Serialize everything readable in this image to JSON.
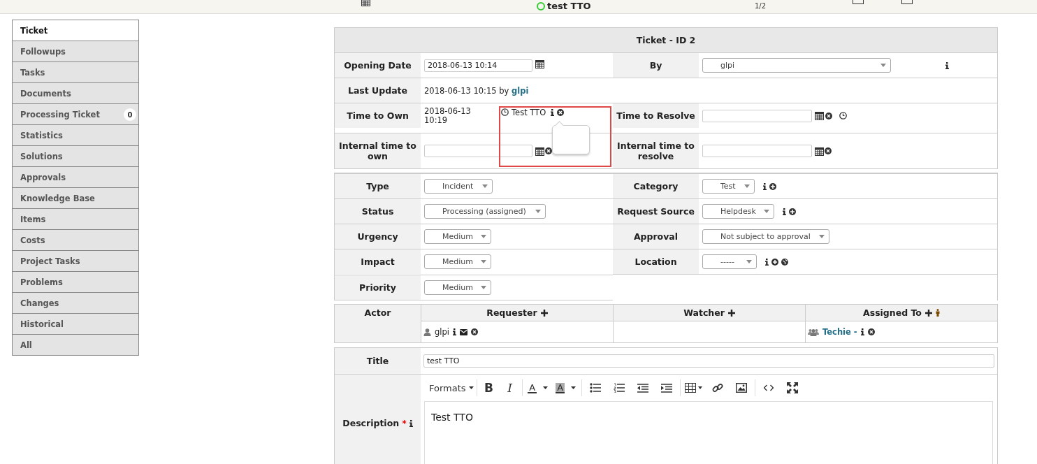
{
  "topbar": {
    "title": "test TTO",
    "counter": "1/2"
  },
  "tabs": [
    {
      "label": "Ticket",
      "selected": true
    },
    {
      "label": "Followups",
      "selected": false
    },
    {
      "label": "Tasks",
      "selected": false
    },
    {
      "label": "Documents",
      "selected": false
    },
    {
      "label": "Processing Ticket",
      "selected": false,
      "badge": "0"
    },
    {
      "label": "Statistics",
      "selected": false
    },
    {
      "label": "Solutions",
      "selected": false
    },
    {
      "label": "Approvals",
      "selected": false
    },
    {
      "label": "Knowledge Base",
      "selected": false
    },
    {
      "label": "Items",
      "selected": false
    },
    {
      "label": "Costs",
      "selected": false
    },
    {
      "label": "Project Tasks",
      "selected": false
    },
    {
      "label": "Problems",
      "selected": false
    },
    {
      "label": "Changes",
      "selected": false
    },
    {
      "label": "Historical",
      "selected": false
    },
    {
      "label": "All",
      "selected": false
    }
  ],
  "form": {
    "header": "Ticket - ID 2",
    "opening_date": {
      "label": "Opening Date",
      "value": "2018-06-13 10:14"
    },
    "by": {
      "label": "By",
      "value": "glpi"
    },
    "last_update": {
      "label": "Last Update",
      "text": "2018-06-13 10:15 by",
      "user": "glpi"
    },
    "time_to_own": {
      "label": "Time to Own",
      "value": "2018-06-13 10:19",
      "sla": "Test TTO"
    },
    "time_to_resolve": {
      "label": "Time to Resolve"
    },
    "internal_time_to_own": {
      "label": "Internal time to own"
    },
    "internal_time_to_resolve": {
      "label": "Internal time to resolve"
    },
    "fields": [
      {
        "label": "Type",
        "value": "Incident"
      },
      {
        "label": "Category",
        "value": "Test"
      },
      {
        "label": "Status",
        "value": "Processing (assigned)"
      },
      {
        "label": "Request Source",
        "value": "Helpdesk"
      },
      {
        "label": "Urgency",
        "value": "Medium"
      },
      {
        "label": "Approval",
        "value": "Not subject to approval"
      },
      {
        "label": "Impact",
        "value": "Medium"
      },
      {
        "label": "Location",
        "value": "-----"
      },
      {
        "label": "Priority",
        "value": "Medium"
      }
    ],
    "actors": {
      "label": "Actor",
      "columns": [
        {
          "label": "Requester",
          "entries": [
            {
              "name": "glpi",
              "kind": "user"
            }
          ]
        },
        {
          "label": "Watcher"
        },
        {
          "label": "Assigned To",
          "entries": [
            {
              "name": "Techie -",
              "kind": "group"
            }
          ]
        }
      ]
    },
    "title": {
      "label": "Title",
      "value": "test TTO"
    },
    "description": {
      "label": "Description",
      "required_mark": "*",
      "content": "Test TTO",
      "toolbar": [
        {
          "kind": "menu",
          "label": "Formats"
        },
        {
          "kind": "bold",
          "label": "B"
        },
        {
          "kind": "italic",
          "label": "I"
        },
        {
          "kind": "forecolor",
          "label": "A"
        },
        {
          "kind": "backcolor",
          "label": "A"
        },
        {
          "kind": "bullist"
        },
        {
          "kind": "numlist"
        },
        {
          "kind": "outdent"
        },
        {
          "kind": "indent"
        },
        {
          "kind": "table"
        },
        {
          "kind": "link"
        },
        {
          "kind": "image"
        },
        {
          "kind": "code"
        },
        {
          "kind": "fullscreen"
        }
      ]
    }
  }
}
